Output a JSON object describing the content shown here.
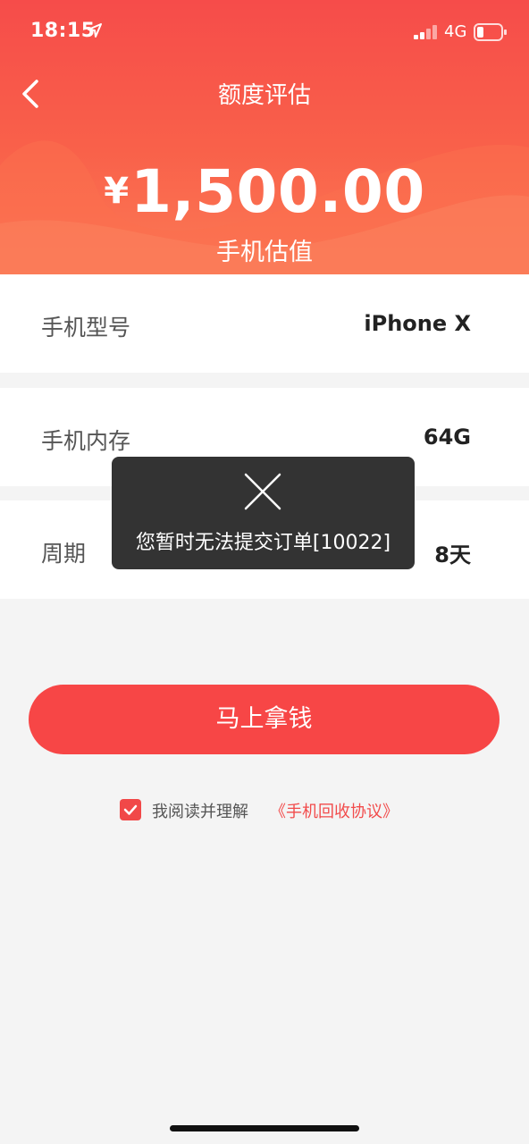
{
  "status_bar": {
    "time": "18:15",
    "network": "4G",
    "icons": [
      "location-arrow-icon",
      "signal-bars-icon",
      "battery-icon"
    ]
  },
  "nav": {
    "title": "额度评估",
    "back_icon": "chevron-left-icon"
  },
  "valuation": {
    "currency": "¥",
    "amount": "1,500.00",
    "label": "手机估值"
  },
  "details": [
    {
      "label": "手机型号",
      "value": "iPhone X"
    },
    {
      "label": "手机内存",
      "value": "64G"
    },
    {
      "label": "周期",
      "value": "8天"
    }
  ],
  "toast": {
    "icon": "close-x-icon",
    "message": "您暂时无法提交订单[10022]"
  },
  "cta": {
    "label": "马上拿钱"
  },
  "agreement": {
    "checked": true,
    "text": "我阅读并理解",
    "link": "《手机回收协议》"
  },
  "colors": {
    "primary": "#f74646",
    "header_top": "#f64c4a",
    "header_bottom": "#fb7a55",
    "page_bg": "#f4f4f4",
    "toast_bg": "#282828"
  }
}
